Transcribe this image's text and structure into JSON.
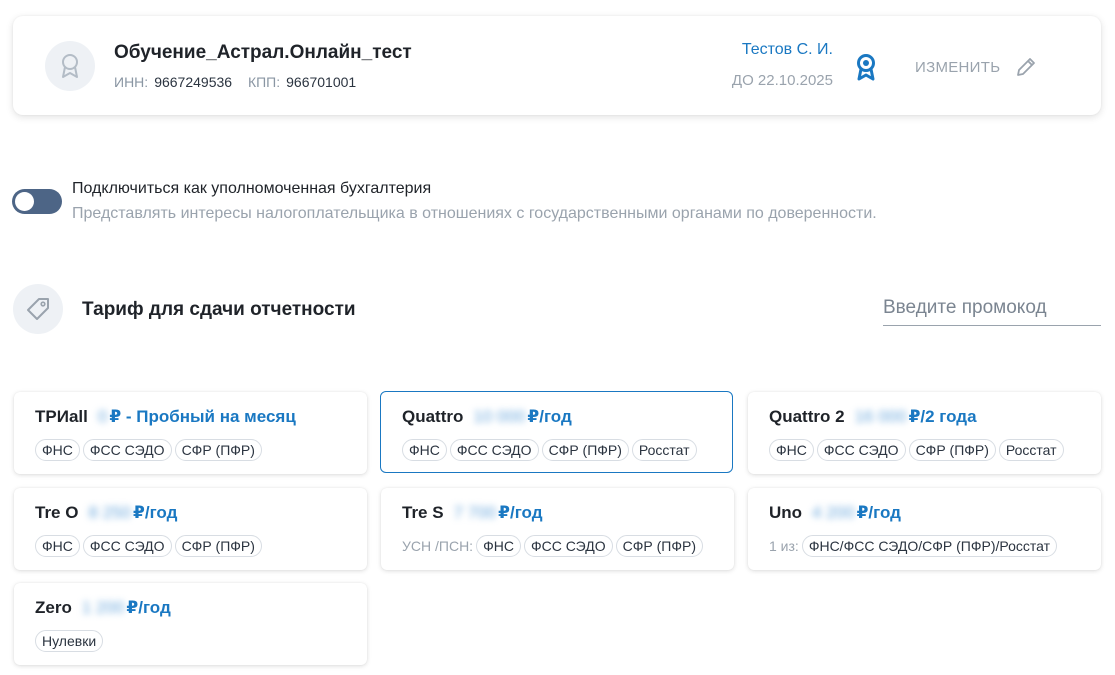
{
  "organization": {
    "name": "Обучение_Астрал.Онлайн_тест",
    "inn_label": "ИНН:",
    "inn": "9667249536",
    "kpp_label": "КПП:",
    "kpp": "966701001"
  },
  "signer": {
    "name": "Тестов С. И.",
    "valid_until": "ДО 22.10.2025",
    "change_label": "ИЗМЕНИТЬ"
  },
  "authorized_accounting": {
    "enabled": false,
    "title": "Подключиться как уполномоченная бухгалтерия",
    "description": "Представлять интересы налогоплательщика в отношениях с государственными органами по доверенности."
  },
  "tariffs": {
    "title": "Тариф для сдачи отчетности",
    "promo_placeholder": "Введите промокод"
  },
  "plans": [
    {
      "name": "ТРИall",
      "amount": "0",
      "suffix": "₽ - Пробный на месяц",
      "prefix": "",
      "tags": [
        "ФНС",
        "ФСС СЭДО",
        "СФР (ПФР)"
      ],
      "selected": false
    },
    {
      "name": "Quattro",
      "amount": "10 000",
      "suffix": "₽/год",
      "prefix": "",
      "tags": [
        "ФНС",
        "ФСС СЭДО",
        "СФР (ПФР)",
        "Росстат"
      ],
      "selected": true
    },
    {
      "name": "Quattro 2",
      "amount": "16 000",
      "suffix": "₽/2 года",
      "prefix": "",
      "tags": [
        "ФНС",
        "ФСС СЭДО",
        "СФР (ПФР)",
        "Росстат"
      ],
      "selected": false
    },
    {
      "name": "Tre O",
      "amount": "8 250",
      "suffix": "₽/год",
      "prefix": "",
      "tags": [
        "ФНС",
        "ФСС СЭДО",
        "СФР (ПФР)"
      ],
      "selected": false
    },
    {
      "name": "Tre S",
      "amount": "7 700",
      "suffix": "₽/год",
      "prefix": "УСН /ПСН:",
      "tags": [
        "ФНС",
        "ФСС СЭДО",
        "СФР (ПФР)"
      ],
      "selected": false
    },
    {
      "name": "Uno",
      "amount": "4 200",
      "suffix": "₽/год",
      "prefix": "1 из:",
      "tags": [
        "ФНС/ФСС СЭДО/СФР (ПФР)/Росстат"
      ],
      "selected": false
    },
    {
      "name": "Zero",
      "amount": "1 200",
      "suffix": "₽/год",
      "prefix": "",
      "tags": [
        "Нулевки"
      ],
      "selected": false
    }
  ],
  "colors": {
    "accent": "#1a78c2",
    "toggle_track": "#4d6586",
    "muted_text": "#9aa3ad"
  }
}
